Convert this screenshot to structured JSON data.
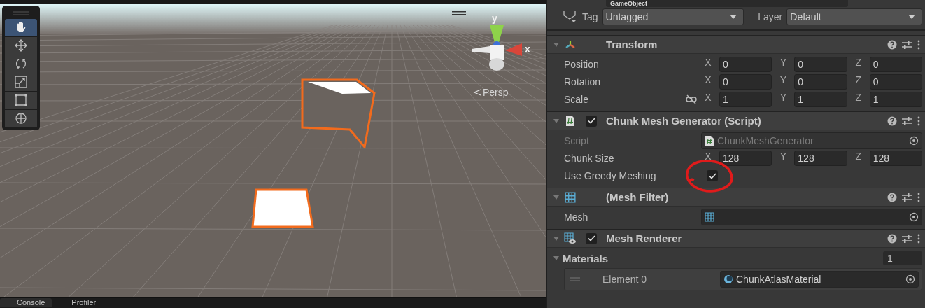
{
  "scene_view": {
    "tools": [
      {
        "kind": "hand",
        "selected": true
      },
      {
        "kind": "move",
        "selected": false
      },
      {
        "kind": "rotate",
        "selected": false
      },
      {
        "kind": "scale",
        "selected": false
      },
      {
        "kind": "rect",
        "selected": false
      },
      {
        "kind": "transform",
        "selected": false
      }
    ],
    "gizmo": {
      "y_label": "y",
      "x_label": "x"
    },
    "projection": "Persp",
    "bottom_tabs": [
      {
        "label": "Console",
        "selected": true
      },
      {
        "label": "Profiler",
        "selected": false
      }
    ]
  },
  "inspector": {
    "object_name": "GameObject",
    "tag": {
      "label": "Tag",
      "value": "Untagged"
    },
    "layer": {
      "label": "Layer",
      "value": "Default"
    },
    "components": [
      {
        "kind": "transform",
        "title": "Transform",
        "expanded": true,
        "rows": [
          {
            "kind": "vector",
            "label": "Position",
            "values": [
              {
                "axis": "X",
                "value": "0"
              },
              {
                "axis": "Y",
                "value": "0"
              },
              {
                "axis": "Z",
                "value": "0"
              }
            ]
          },
          {
            "kind": "vector",
            "label": "Rotation",
            "values": [
              {
                "axis": "X",
                "value": "0"
              },
              {
                "axis": "Y",
                "value": "0"
              },
              {
                "axis": "Z",
                "value": "0"
              }
            ]
          },
          {
            "kind": "vector",
            "label": "Scale",
            "linked": false,
            "values": [
              {
                "axis": "X",
                "value": "1"
              },
              {
                "axis": "Y",
                "value": "1"
              },
              {
                "axis": "Z",
                "value": "1"
              }
            ]
          }
        ]
      },
      {
        "kind": "script",
        "title": "Chunk Mesh Generator (Script)",
        "enabled": true,
        "expanded": true,
        "rows": [
          {
            "kind": "object",
            "label": "Script",
            "value": "ChunkMeshGenerator",
            "disabled": true
          },
          {
            "kind": "vector",
            "label": "Chunk Size",
            "values": [
              {
                "axis": "X",
                "value": "128"
              },
              {
                "axis": "Y",
                "value": "128"
              },
              {
                "axis": "Z",
                "value": "128"
              }
            ]
          },
          {
            "kind": "toggle",
            "label": "Use Greedy Meshing",
            "checked": true,
            "annotated": true
          }
        ]
      },
      {
        "kind": "mesh_filter",
        "title": "(Mesh Filter)",
        "expanded": true,
        "rows": [
          {
            "kind": "object",
            "label": "Mesh",
            "disabled": false
          }
        ]
      },
      {
        "kind": "mesh_renderer",
        "title": "Mesh Renderer",
        "enabled": true,
        "expanded": true,
        "rows": [
          {
            "kind": "list",
            "label": "Materials",
            "count": "1",
            "expanded": true,
            "elements": [
              {
                "label": "Element 0",
                "value": "ChunkAtlasMaterial"
              }
            ]
          }
        ]
      }
    ]
  }
}
